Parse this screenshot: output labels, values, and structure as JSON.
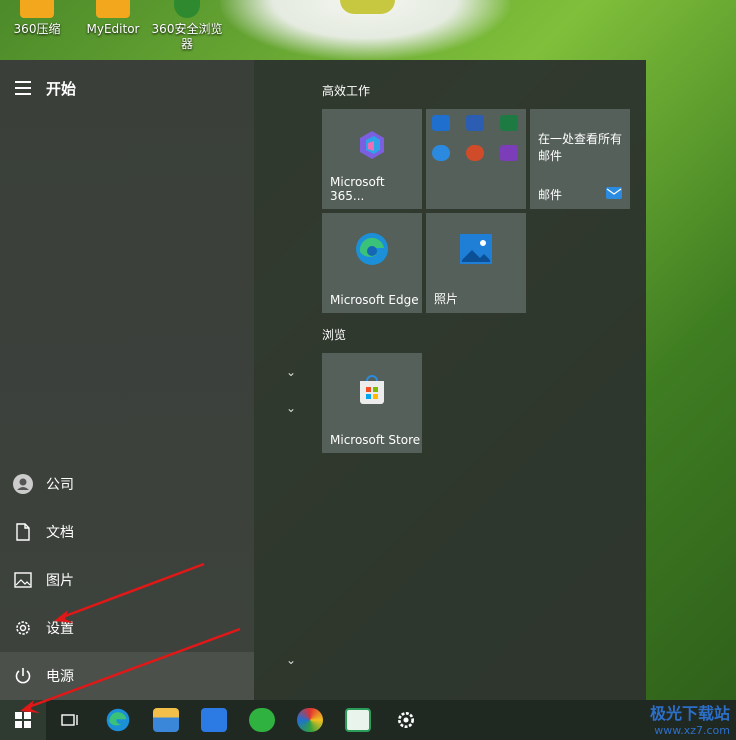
{
  "desktop": {
    "icons": [
      {
        "label": "360压缩",
        "color": "#f2a71c"
      },
      {
        "label": "MyEditor",
        "color": "#f2a71c"
      },
      {
        "label": "360安全浏览器",
        "color": "#2f8a2f"
      }
    ]
  },
  "start_menu": {
    "title": "开始",
    "rail": {
      "user": "公司",
      "documents": "文档",
      "pictures": "图片",
      "settings": "设置",
      "power": "电源"
    },
    "groups": [
      {
        "label": "高效工作"
      },
      {
        "label": "浏览"
      }
    ],
    "tiles": {
      "m365": "Microsoft 365...",
      "office_apps": [
        "outlook-icon",
        "word-icon",
        "excel-icon",
        "onedrive-icon",
        "powerpoint-icon",
        "onenote-icon"
      ],
      "mail_desc": "在一处查看所有邮件",
      "mail": "邮件",
      "edge": "Microsoft Edge",
      "photos": "照片",
      "store": "Microsoft Store"
    }
  },
  "taskbar": {
    "apps": [
      "task-view-icon",
      "edge-icon",
      "file-explorer-icon",
      "feishu-icon",
      "wechat-icon",
      "color-app-icon",
      "green-r-icon",
      "settings-gear-icon"
    ]
  },
  "watermark": {
    "title": "极光下载站",
    "url": "www.xz7.com"
  },
  "colors": {
    "accent_red": "#e01818",
    "tile_bg": "#56605a",
    "taskbar": "#202822"
  }
}
